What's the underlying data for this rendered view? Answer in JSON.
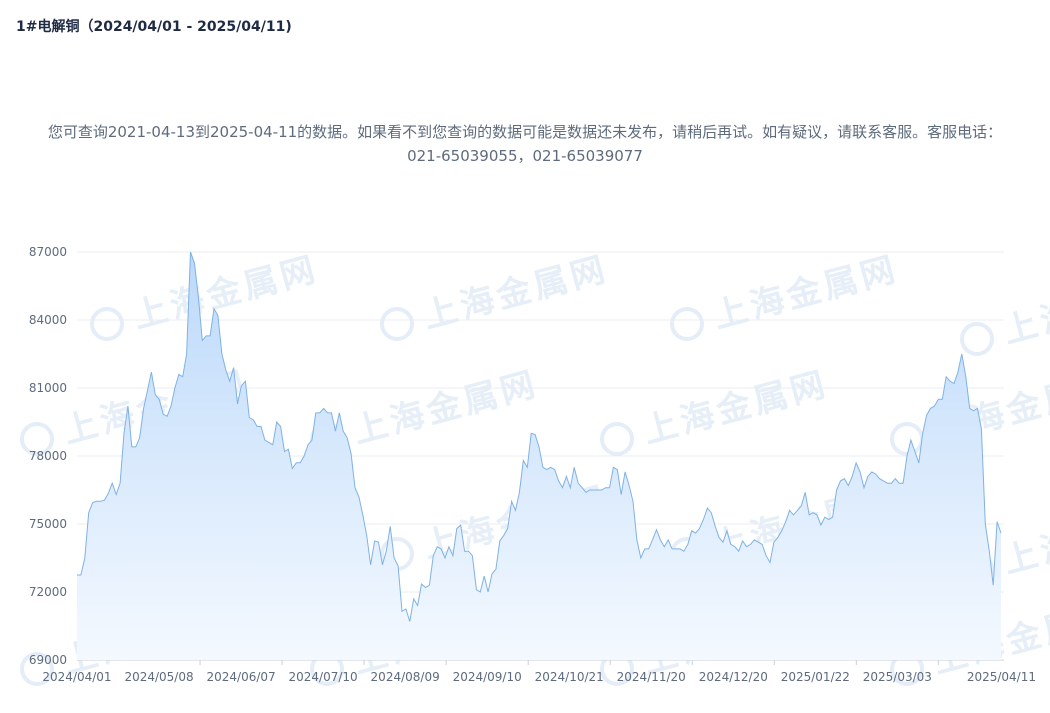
{
  "page": {
    "title": "1#电解铜（2024/04/01 - 2025/04/11)",
    "notice": "您可查询2021-04-13到2025-04-11的数据。如果看不到您查询的数据可能是数据还未发布，请稍后再试。如有疑议，请联系客服。客服电话：021-65039055，021-65039077",
    "watermark_text": "上海金属网"
  },
  "colors": {
    "line": "#7fb2e5",
    "fill_top": "#bcd9fa",
    "fill_bottom": "#f4f9ff",
    "grid": "#e8ecf2",
    "axis": "#c8d0dc"
  },
  "chart_data": {
    "type": "area",
    "title": "1#电解铜（2024/04/01 - 2025/04/11)",
    "xlabel": "",
    "ylabel": "",
    "ylim": [
      69000,
      87000
    ],
    "yticks": [
      69000,
      72000,
      75000,
      78000,
      81000,
      84000,
      87000
    ],
    "xtick_labels": [
      "2024/04/01",
      "2024/05/08",
      "2024/06/07",
      "2024/07/10",
      "2024/08/09",
      "2024/09/10",
      "2024/10/21",
      "2024/11/20",
      "2024/12/20",
      "2025/01/22",
      "2025/03/03",
      "2025/04/11"
    ],
    "grid": true,
    "legend": "none",
    "series": [
      {
        "values": [
          72750,
          72750,
          73500,
          75500,
          75950,
          76000,
          76000,
          76050,
          76350,
          76800,
          76300,
          76800,
          79000,
          80200,
          78400,
          78400,
          78800,
          80100,
          80900,
          81700,
          80700,
          80500,
          79850,
          79750,
          80200,
          81000,
          81600,
          81500,
          82500,
          87000,
          86500,
          85000,
          83100,
          83300,
          83300,
          84500,
          84200,
          82500,
          81800,
          81300,
          81900,
          80300,
          81100,
          81300,
          79700,
          79600,
          79300,
          79300,
          78700,
          78600,
          78500,
          79500,
          79300,
          78200,
          78300,
          77450,
          77700,
          77700,
          78000,
          78500,
          78700,
          79900,
          79900,
          80100,
          79900,
          79900,
          79100,
          79900,
          79100,
          78800,
          78100,
          76600,
          76200,
          75400,
          74500,
          73200,
          74250,
          74200,
          73200,
          73800,
          74900,
          73500,
          73150,
          71150,
          71250,
          70700,
          71700,
          71400,
          72350,
          72200,
          72300,
          73600,
          74000,
          73900,
          73500,
          74000,
          73600,
          74800,
          74950,
          73800,
          73800,
          73600,
          72100,
          72000,
          72700,
          72000,
          72800,
          73000,
          74250,
          74500,
          74800,
          76000,
          75600,
          76400,
          77800,
          77500,
          79000,
          78950,
          78400,
          77500,
          77400,
          77500,
          77400,
          76900,
          76600,
          77100,
          76600,
          77500,
          76800,
          76600,
          76400,
          76500,
          76500,
          76500,
          76500,
          76600,
          76600,
          77500,
          77400,
          76300,
          77300,
          76700,
          76000,
          74300,
          73500,
          73900,
          73900,
          74300,
          74750,
          74300,
          74000,
          74300,
          73900,
          73900,
          73900,
          73800,
          74100,
          74700,
          74600,
          74800,
          75200,
          75700,
          75500,
          74900,
          74400,
          74200,
          74700,
          74100,
          74000,
          73800,
          74250,
          74000,
          74100,
          74300,
          74200,
          74100,
          73600,
          73300,
          74200,
          74400,
          74700,
          75100,
          75600,
          75400,
          75600,
          75800,
          76400,
          75400,
          75500,
          75400,
          74950,
          75300,
          75200,
          75300,
          76500,
          76900,
          77000,
          76700,
          77100,
          77700,
          77300,
          76600,
          77100,
          77300,
          77200,
          77000,
          76900,
          76800,
          76800,
          77000,
          76800,
          76800,
          78000,
          78700,
          78200,
          77700,
          79000,
          79800,
          80100,
          80200,
          80500,
          80500,
          81500,
          81300,
          81200,
          81700,
          82500,
          81500,
          80100,
          80000,
          80100,
          79200,
          75000,
          73800,
          72300,
          75100,
          74600
        ]
      }
    ]
  }
}
